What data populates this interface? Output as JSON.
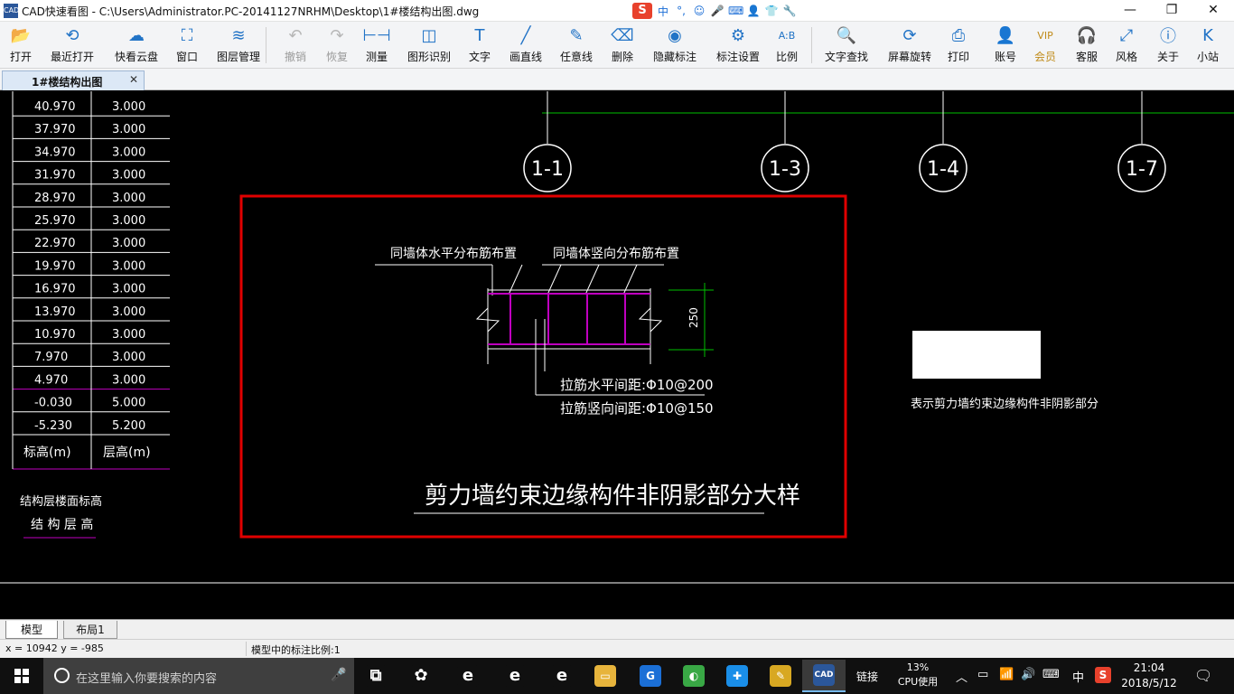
{
  "window": {
    "title": "CAD快速看图 - C:\\Users\\Administrator.PC-20141127NRHM\\Desktop\\1#楼结构出图.dwg",
    "app_icon": "CAD",
    "minimize": "—",
    "maximize": "❐",
    "close": "✕"
  },
  "ime": {
    "logo": "S",
    "lang": "中",
    "punct": "°,",
    "emoji": "☺",
    "voice": "🎤",
    "keyboard": "⌨",
    "user": "👤",
    "skin": "👕",
    "tools": "🔧"
  },
  "toolbar": {
    "items": [
      {
        "label": "打开",
        "icon": "folder-open-icon",
        "glyph": "📂"
      },
      {
        "label": "最近打开",
        "icon": "history-icon",
        "glyph": "⟲"
      },
      {
        "label": "快看云盘",
        "icon": "cloud-icon",
        "glyph": "☁"
      },
      {
        "label": "窗口",
        "icon": "window-icon",
        "glyph": "⛶"
      },
      {
        "label": "图层管理",
        "icon": "layers-icon",
        "glyph": "≋"
      },
      {
        "label": "撤销",
        "icon": "undo-icon",
        "glyph": "↶"
      },
      {
        "label": "恢复",
        "icon": "redo-icon",
        "glyph": "↷"
      },
      {
        "label": "测量",
        "icon": "ruler-icon",
        "glyph": "⊢⊣"
      },
      {
        "label": "图形识别",
        "icon": "shape-recognize-icon",
        "glyph": "◫"
      },
      {
        "label": "文字",
        "icon": "text-icon",
        "glyph": "T"
      },
      {
        "label": "画直线",
        "icon": "line-icon",
        "glyph": "╱"
      },
      {
        "label": "任意线",
        "icon": "pen-icon",
        "glyph": "✎"
      },
      {
        "label": "删除",
        "icon": "eraser-icon",
        "glyph": "⌫"
      },
      {
        "label": "隐藏标注",
        "icon": "eye-hide-icon",
        "glyph": "◉"
      },
      {
        "label": "标注设置",
        "icon": "gear-icon",
        "glyph": "⚙"
      },
      {
        "label": "比例",
        "icon": "scale-icon",
        "glyph": "A:B"
      },
      {
        "label": "文字查找",
        "icon": "search-text-icon",
        "glyph": "🔍"
      },
      {
        "label": "屏幕旋转",
        "icon": "rotate-screen-icon",
        "glyph": "⟳"
      },
      {
        "label": "打印",
        "icon": "printer-icon",
        "glyph": "⎙"
      },
      {
        "label": "账号",
        "icon": "user-icon",
        "glyph": "👤"
      },
      {
        "label": "会员",
        "icon": "vip-icon",
        "glyph": "VIP"
      },
      {
        "label": "客服",
        "icon": "headset-icon",
        "glyph": "🎧"
      },
      {
        "label": "风格",
        "icon": "style-icon",
        "glyph": "⤢"
      },
      {
        "label": "关于",
        "icon": "info-icon",
        "glyph": "ⓘ"
      },
      {
        "label": "小站",
        "icon": "k-logo-icon",
        "glyph": "K"
      }
    ]
  },
  "doc_tab": {
    "label": "1#楼结构出图",
    "close": "✕"
  },
  "drawing": {
    "level_table": {
      "elevations": [
        "40.970",
        "37.970",
        "34.970",
        "31.970",
        "28.970",
        "25.970",
        "22.970",
        "19.970",
        "16.970",
        "13.970",
        "10.970",
        "7.970",
        "4.970",
        "-0.030",
        "-5.230"
      ],
      "heights": [
        "3.000",
        "3.000",
        "3.000",
        "3.000",
        "3.000",
        "3.000",
        "3.000",
        "3.000",
        "3.000",
        "3.000",
        "3.000",
        "3.000",
        "3.000",
        "5.000",
        "5.200"
      ],
      "header_elevation": "标高(m)",
      "header_height": "层高(m)",
      "caption_line1": "结构层楼面标高",
      "caption_line2": "结 构 层 高"
    },
    "axes": [
      "1-1",
      "1-3",
      "1-4",
      "1-7"
    ],
    "detail": {
      "label_horizontal": "同墙体水平分布筋布置",
      "label_vertical": "同墙体竖向分布筋布置",
      "dimension": "250",
      "tie_horizontal": "拉筋水平间距:Φ10@200",
      "tie_vertical": "拉筋竖向间距:Φ10@150",
      "title": "剪力墙约束边缘构件非阴影部分大样"
    },
    "legend_text": "表示剪力墙约束边缘构件非阴影部分"
  },
  "layout_tabs": [
    "模型",
    "布局1"
  ],
  "status": {
    "coords": "x = 10942  y = -985",
    "scale": "模型中的标注比例:1"
  },
  "taskbar": {
    "search_placeholder": "在这里输入你要搜索的内容",
    "apps": [
      {
        "name": "task-view",
        "color": "#101010",
        "glyph": "⧉"
      },
      {
        "name": "pinwheel-app",
        "color": "#101010",
        "glyph": "✿"
      },
      {
        "name": "edge-browser",
        "color": "#101010",
        "glyph": "e"
      },
      {
        "name": "browser-360",
        "color": "#101010",
        "glyph": "e"
      },
      {
        "name": "internet-explorer",
        "color": "#101010",
        "glyph": "e"
      },
      {
        "name": "file-explorer",
        "color": "#e7b43c",
        "glyph": "▭"
      },
      {
        "name": "sogou-browser",
        "color": "#1b6fd6",
        "glyph": "G"
      },
      {
        "name": "green-app",
        "color": "#39a845",
        "glyph": "◐"
      },
      {
        "name": "blue-plus-app",
        "color": "#1a8ee8",
        "glyph": "✚"
      },
      {
        "name": "notes-app",
        "color": "#d8a822",
        "glyph": "✎"
      },
      {
        "name": "cad-viewer",
        "color": "#2b579a",
        "glyph": "CAD"
      }
    ],
    "tray_link": "链接",
    "cpu_percent": "13%",
    "cpu_label": "CPU使用",
    "tray_chevron": "︿",
    "tray_battery": "▭",
    "tray_network": "📶",
    "tray_volume": "🔊",
    "tray_keyboard": "⌨",
    "tray_ime": "中",
    "tray_sogou": "S",
    "time": "21:04",
    "date": "2018/5/12",
    "notification": "🗨"
  }
}
